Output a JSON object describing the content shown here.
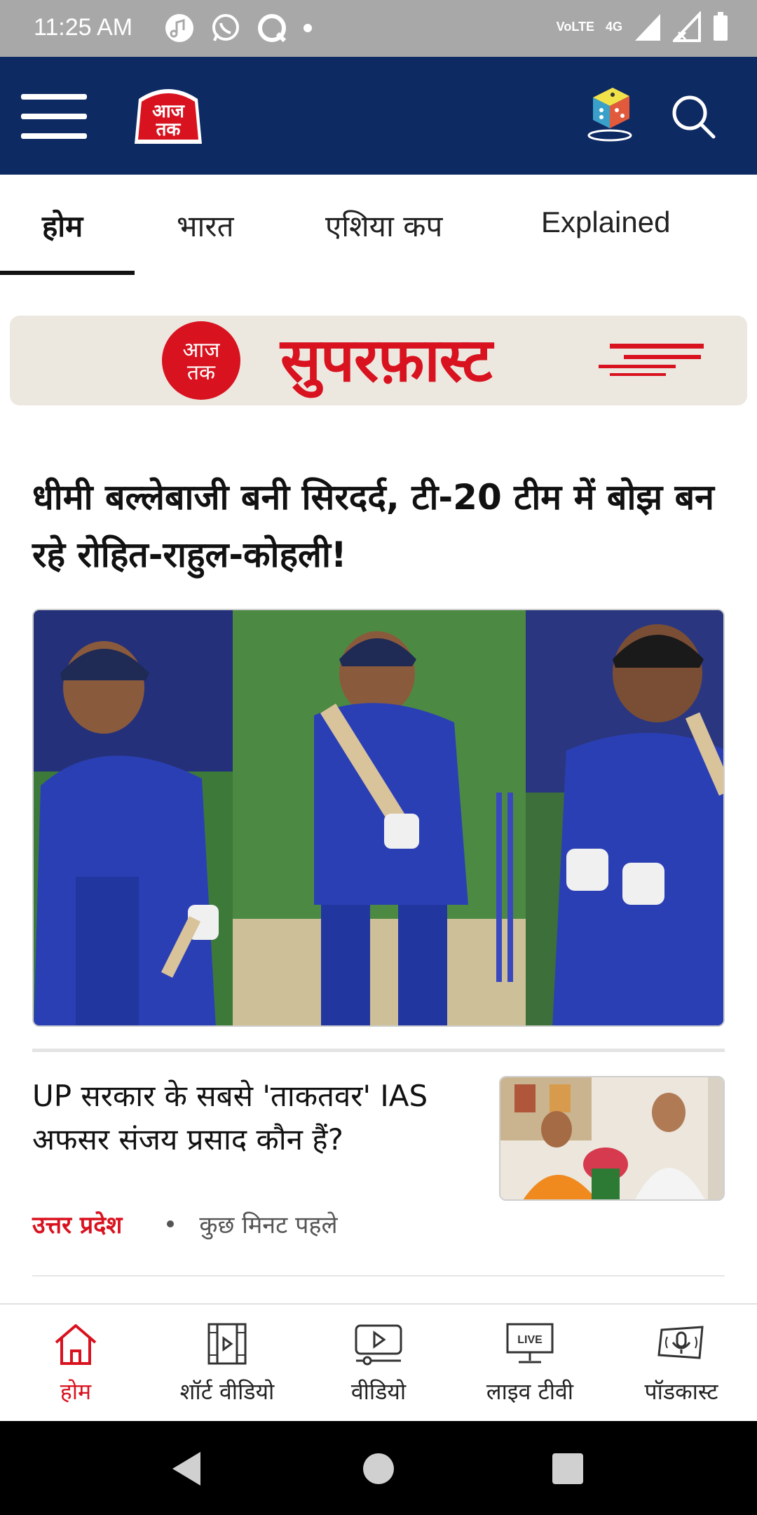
{
  "status_bar": {
    "time": "11:25 AM",
    "network": "4G",
    "volte": "VoLTE"
  },
  "header": {
    "logo_text": "आज तक",
    "icons": [
      "menu-icon",
      "dice-icon",
      "search-icon"
    ]
  },
  "tabs": [
    {
      "label": "होम",
      "active": true
    },
    {
      "label": "भारत",
      "active": false
    },
    {
      "label": "एशिया कप",
      "active": false
    },
    {
      "label": "Explained",
      "active": false
    }
  ],
  "banner": {
    "logo_text": "आज तक",
    "text": "सुपरफ़ास्ट"
  },
  "headline": "धीमी बल्लेबाजी बनी सिरदर्द, टी-20 टीम में बोझ बन रहे रोहित-राहुल-कोहली!",
  "story": {
    "title": "UP सरकार के सबसे 'ताकतवर' IAS अफसर संजय प्रसाद कौन हैं?",
    "category": "उत्तर प्रदेश",
    "time": "कुछ मिनट पहले"
  },
  "bottom_nav": [
    {
      "label": "होम",
      "icon": "home-icon",
      "active": true
    },
    {
      "label": "शॉर्ट वीडियो",
      "icon": "short-video-icon",
      "active": false
    },
    {
      "label": "वीडियो",
      "icon": "video-icon",
      "active": false
    },
    {
      "label": "लाइव टीवी",
      "icon": "live-tv-icon",
      "active": false
    },
    {
      "label": "पॉडकास्ट",
      "icon": "podcast-icon",
      "active": false
    }
  ],
  "colors": {
    "header_bg": "#0e2a63",
    "accent_red": "#d9121f",
    "status_bg": "#a8a8a8"
  }
}
